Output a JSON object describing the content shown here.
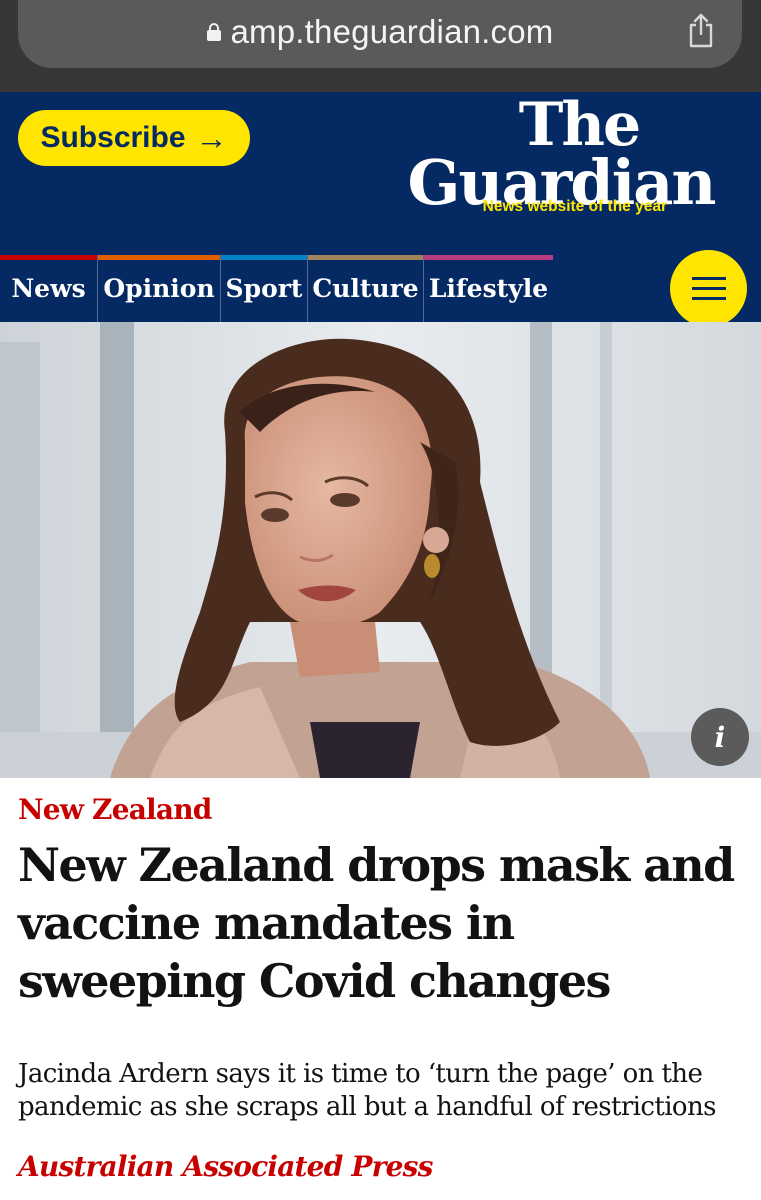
{
  "browser": {
    "url": "amp.theguardian.com",
    "icons": {
      "lock": "lock-icon",
      "share": "share-icon"
    }
  },
  "masthead": {
    "subscribe_label": "Subscribe",
    "subscribe_arrow": "→",
    "logo_line1": "The",
    "logo_line2": "Guardian",
    "tagline": "News website of the year",
    "colors": {
      "brand_blue": "#052962",
      "brand_yellow": "#ffe500"
    }
  },
  "nav": {
    "items": [
      {
        "label": "News",
        "color": "#c70000"
      },
      {
        "label": "Opinion",
        "color": "#e05e00"
      },
      {
        "label": "Sport",
        "color": "#0084c6"
      },
      {
        "label": "Culture",
        "color": "#a1845c"
      },
      {
        "label": "Lifestyle",
        "color": "#bb3b80"
      }
    ],
    "menu_icon": "hamburger-menu-icon"
  },
  "hero": {
    "info_label": "i"
  },
  "article": {
    "kicker": "New Zealand",
    "headline": "New Zealand drops mask and vaccine mandates in sweeping Covid changes",
    "standfirst": "Jacinda Ardern says it is time to ‘turn the page’ on the pandemic as she scraps all but a handful of restrictions",
    "byline": "Australian Associated Press",
    "colors": {
      "kicker": "#c70000"
    }
  }
}
